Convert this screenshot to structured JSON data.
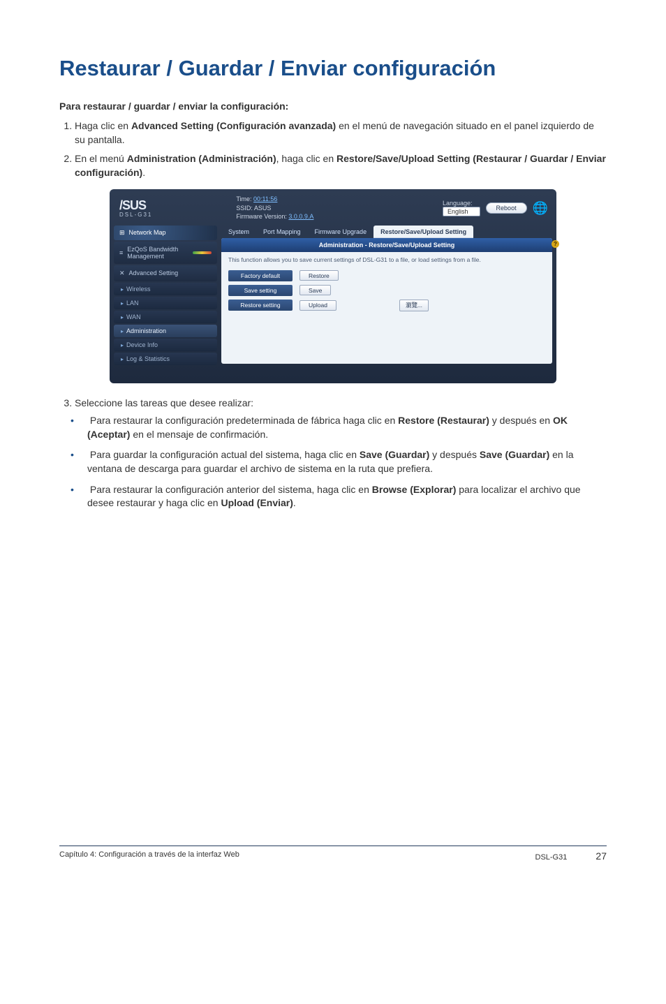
{
  "title": "Restaurar / Guardar / Enviar configuración",
  "subhead": "Para restaurar / guardar / enviar la configuración:",
  "steps": {
    "s1_pre": "Haga clic en ",
    "s1_b": "Advanced Setting (Configuración avanzada)",
    "s1_post": " en el menú de navegación situado en el panel izquierdo de su pantalla.",
    "s2_pre": "En el menú ",
    "s2_b1": "Administration (Administración)",
    "s2_mid": ", haga clic en ",
    "s2_b2": "Restore/Save/Upload Setting (Restaurar / Guardar / Enviar configuración)",
    "s2_post": ".",
    "s3": "Seleccione las tareas que desee realizar:"
  },
  "tasks": {
    "t1_pre": "Para restaurar la configuración predeterminada de fábrica haga clic en ",
    "t1_b1": "Restore (Restaurar)",
    "t1_mid": " y después en ",
    "t1_b2": "OK (Aceptar)",
    "t1_post": " en el mensaje de confirmación.",
    "t2_pre": "Para guardar la configuración actual del sistema, haga clic en ",
    "t2_b1": "Save (Guardar)",
    "t2_mid": " y después ",
    "t2_b2": "Save (Guardar)",
    "t2_post": " en la ventana de descarga para guardar el archivo de sistema en la ruta que prefiera.",
    "t3_pre": "Para restaurar la configuración anterior del sistema, haga clic en ",
    "t3_b1": "Browse (Explorar)",
    "t3_mid": " para localizar el archivo que desee restaurar y haga clic en ",
    "t3_b2": "Upload (Enviar)",
    "t3_post": "."
  },
  "shot": {
    "brand": "/SUS",
    "model": "DSL-G31",
    "time_label": "Time:",
    "time_value": "00:11:56",
    "ssid_label": "SSID: ASUS",
    "fw_label": "Firmware Version:",
    "fw_value": "3.0.0.9.A",
    "language_label": "Language:",
    "language_value": "English",
    "reboot": "Reboot",
    "sidebar": {
      "network_map": "Network Map",
      "ezqos": "EzQoS Bandwidth Management",
      "advanced": "Advanced Setting",
      "items": [
        "Wireless",
        "LAN",
        "WAN",
        "Administration",
        "Device Info",
        "Log & Statistics"
      ]
    },
    "tabs": [
      "System",
      "Port Mapping",
      "Firmware Upgrade",
      "Restore/Save/Upload Setting"
    ],
    "panel_title": "Administration - Restore/Save/Upload Setting",
    "panel_desc": "This function allows you to save current settings of DSL-G31 to a file, or load settings from a file.",
    "rows": {
      "factory": "Factory default",
      "restore_btn": "Restore",
      "save_lbl": "Save setting",
      "save_btn": "Save",
      "restore_lbl": "Restore setting",
      "upload_btn": "Upload",
      "browse_btn": "瀏覽..."
    }
  },
  "footer": {
    "left": "Capítulo 4: Configuración a través de la interfaz Web",
    "right": "DSL-G31",
    "page": "27"
  }
}
